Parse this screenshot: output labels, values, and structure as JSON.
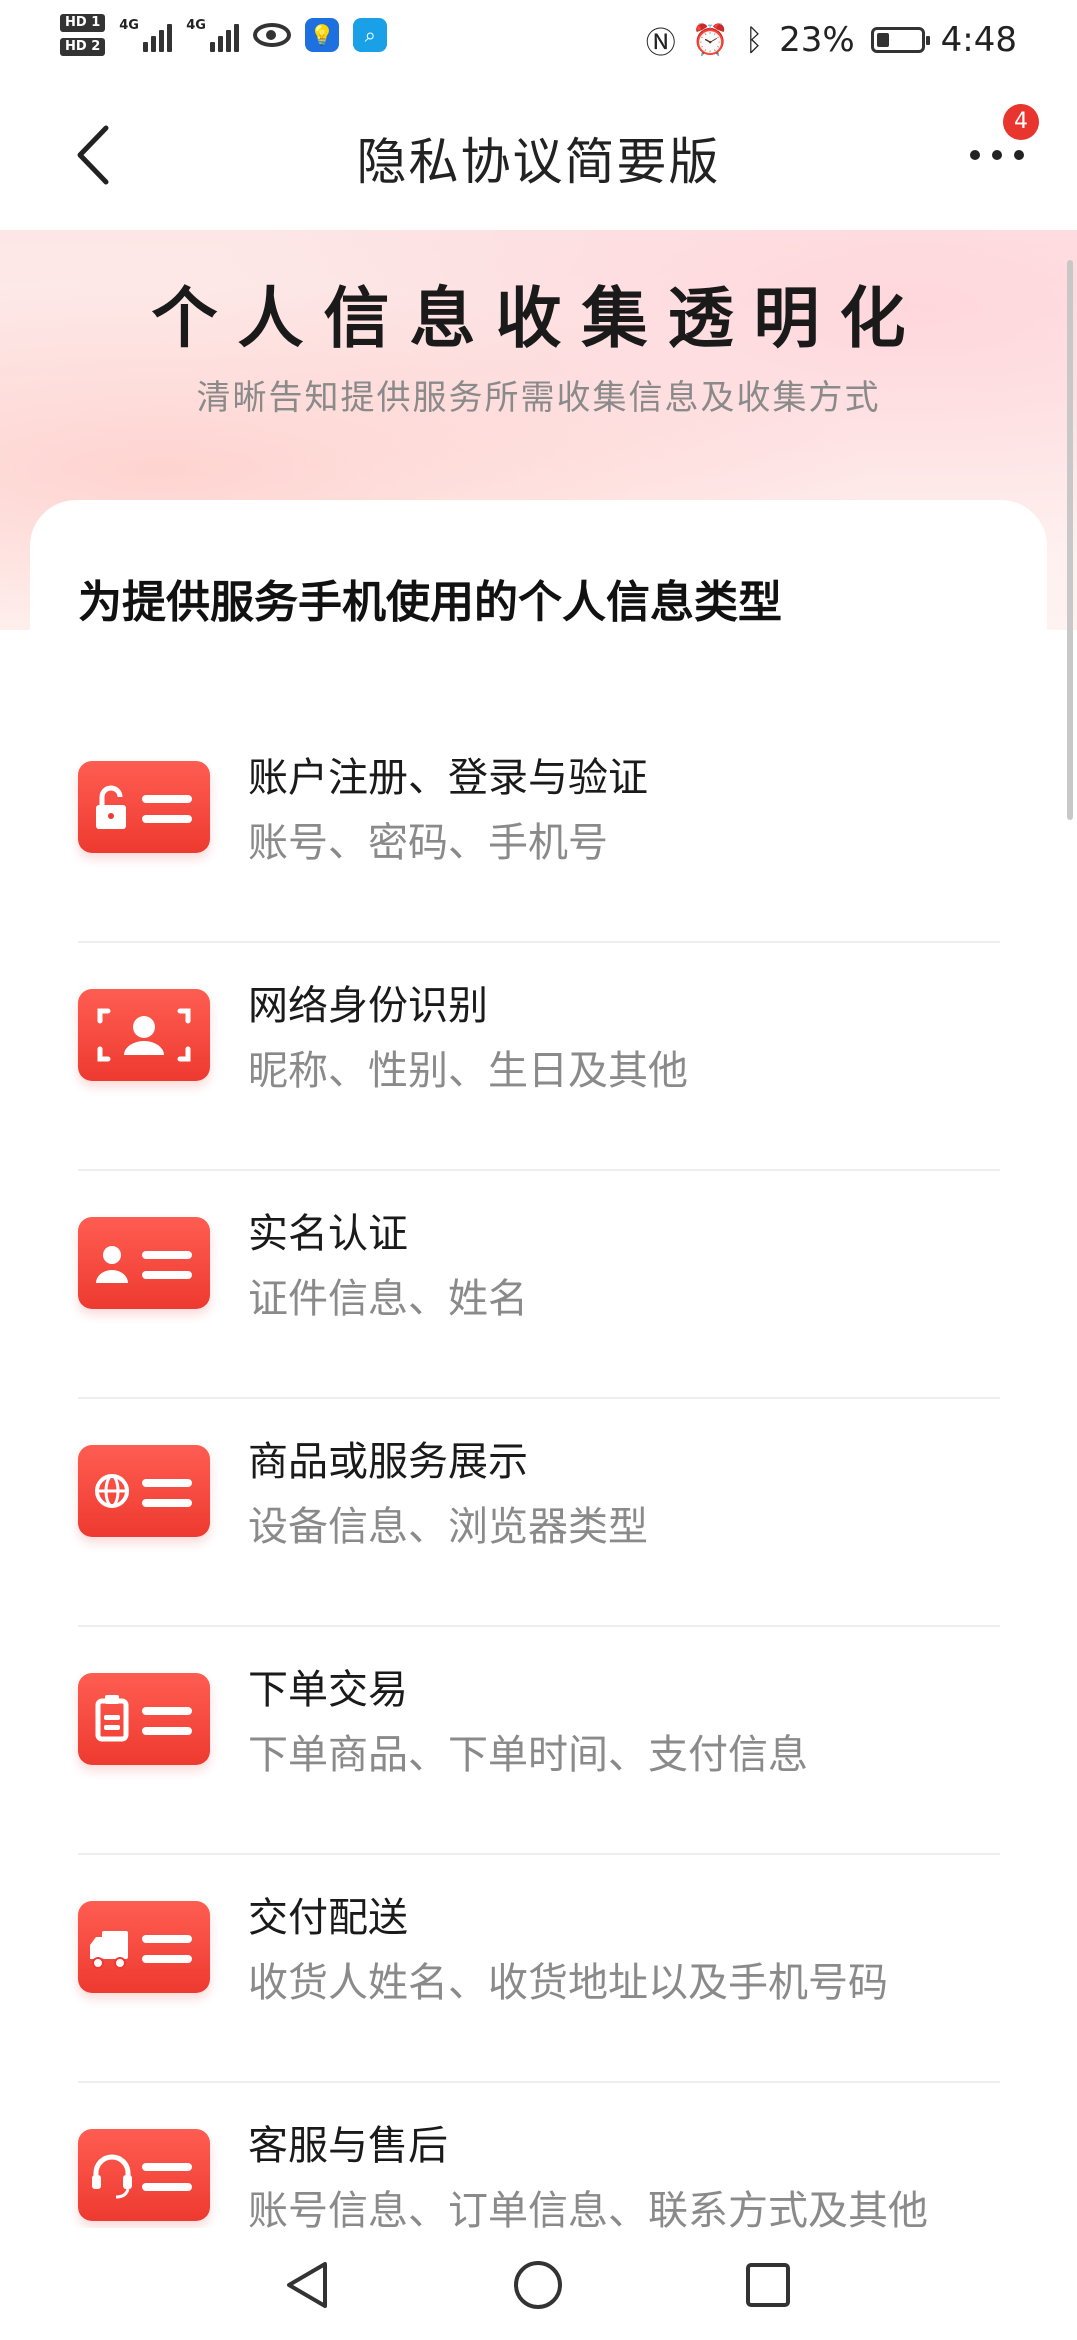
{
  "status_bar": {
    "sim1": "HD 1",
    "sim2": "HD 2",
    "net1": "4G",
    "net2": "4G",
    "battery": "23%",
    "time": "4:48"
  },
  "header": {
    "title": "隐私协议简要版",
    "badge_count": "4"
  },
  "hero": {
    "title": "个人信息收集透明化",
    "subtitle": "清晰告知提供服务所需收集信息及收集方式"
  },
  "section": {
    "title": "为提供服务手机使用的个人信息类型",
    "items": [
      {
        "title": "账户注册、登录与验证",
        "desc": "账号、密码、手机号",
        "icon": "lock-card-icon"
      },
      {
        "title": "网络身份识别",
        "desc": "昵称、性别、生日及其他",
        "icon": "face-scan-icon"
      },
      {
        "title": "实名认证",
        "desc": "证件信息、姓名",
        "icon": "id-card-icon"
      },
      {
        "title": "商品或服务展示",
        "desc": "设备信息、浏览器类型",
        "icon": "globe-card-icon"
      },
      {
        "title": "下单交易",
        "desc": "下单商品、下单时间、支付信息",
        "icon": "clipboard-card-icon"
      },
      {
        "title": "交付配送",
        "desc": "收货人姓名、收货地址以及手机号码",
        "icon": "truck-card-icon"
      },
      {
        "title": "客服与售后",
        "desc": "账号信息、订单信息、联系方式及其他",
        "icon": "headset-card-icon"
      }
    ]
  },
  "colors": {
    "accent": "#ee3a30",
    "badge": "#e8352d",
    "hero_bg": "#fde7e6"
  }
}
